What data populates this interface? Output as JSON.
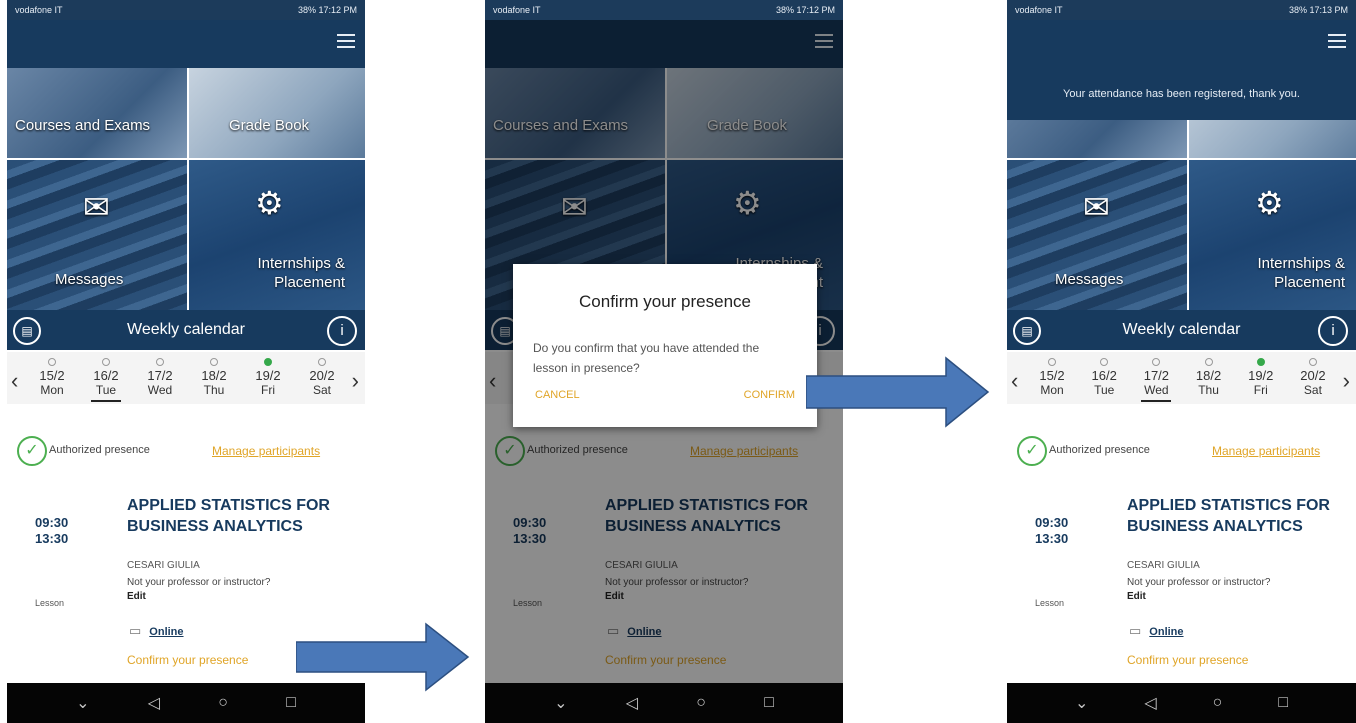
{
  "status_bar": {
    "left": "vodafone IT",
    "right": "38% 17:12 PM",
    "right3": "38% 17:13 PM"
  },
  "tiles": {
    "courses": "Courses and Exams",
    "grades": "Grade Book",
    "messages": "Messages",
    "internships_line1": "Internships &",
    "internships_line2": "Placement"
  },
  "calendar": {
    "title": "Weekly calendar"
  },
  "days": [
    {
      "date": "15/2",
      "name": "Mon"
    },
    {
      "date": "16/2",
      "name": "Tue"
    },
    {
      "date": "17/2",
      "name": "Wed"
    },
    {
      "date": "18/2",
      "name": "Thu"
    },
    {
      "date": "19/2",
      "name": "Fri"
    },
    {
      "date": "20/2",
      "name": "Sat"
    }
  ],
  "presence": {
    "authorized": "Authorized presence",
    "manage": "Manage participants"
  },
  "lesson": {
    "start": "09:30",
    "end": "13:30",
    "type": "Lesson",
    "course_line1": "APPLIED STATISTICS FOR",
    "course_line2": "BUSINESS ANALYTICS",
    "professor": "CESARI GIULIA",
    "question": "Not your professor or instructor?",
    "edit": "Edit",
    "online": "Online",
    "confirm": "Confirm your presence"
  },
  "dialog": {
    "title": "Confirm your presence",
    "body": "Do you confirm that you have attended the lesson in presence?",
    "cancel": "CANCEL",
    "confirm": "CONFIRM"
  },
  "toast": "Your attendance has been registered, thank you.",
  "colors": {
    "primary": "#173a5e",
    "accent": "#e0a528",
    "success": "#4caf50",
    "arrow": "#4a78b8"
  },
  "icons": {
    "menu": "hamburger-icon",
    "calendar": "calendar-icon",
    "info": "info-icon",
    "check": "check-circle-icon",
    "online": "video-icon"
  }
}
